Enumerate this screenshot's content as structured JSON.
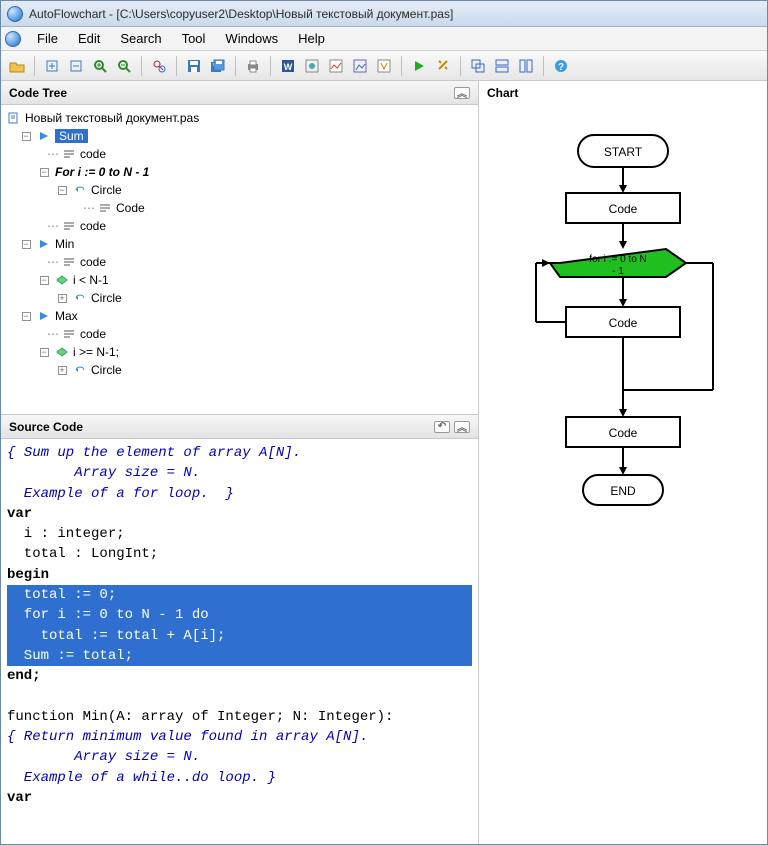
{
  "window": {
    "title": "AutoFlowchart - [C:\\Users\\copyuser2\\Desktop\\Новый текстовый документ.pas]"
  },
  "menu": {
    "items": [
      "File",
      "Edit",
      "Search",
      "Tool",
      "Windows",
      "Help"
    ]
  },
  "panels": {
    "codetree_title": "Code Tree",
    "source_title": "Source Code",
    "chart_title": "Chart"
  },
  "codetree": {
    "root": "Новый текстовый документ.pas",
    "sum": "Sum",
    "code": "code",
    "for_line": "For  i := 0 to N - 1",
    "circle": "Circle",
    "code2": "Code",
    "min": "Min",
    "cond_min": "i < N-1",
    "max": "Max",
    "cond_max": "i >= N-1;"
  },
  "source": {
    "l1": "{ Sum up the element of array A[N].",
    "l2": "        Array size = N.",
    "l3": "  Example of a for loop.  }",
    "l4": "var",
    "l5": "  i : integer;",
    "l6": "  total : LongInt;",
    "l7": "begin",
    "l8": "  total := 0;",
    "l9": "  for i := 0 to N - 1 do",
    "l10": "    total := total + A[i];",
    "l11": "",
    "l12": "  Sum := total;",
    "l13": "end;",
    "l14": "",
    "l15": "function Min(A: array of Integer; N: Integer):",
    "l16": "{ Return minimum value found in array A[N].",
    "l17": "        Array size = N.",
    "l18": "  Example of a while..do loop. }",
    "l19": "var"
  },
  "chart": {
    "start": "START",
    "code": "Code",
    "for": "for i := 0 to N - 1",
    "end": "END"
  }
}
